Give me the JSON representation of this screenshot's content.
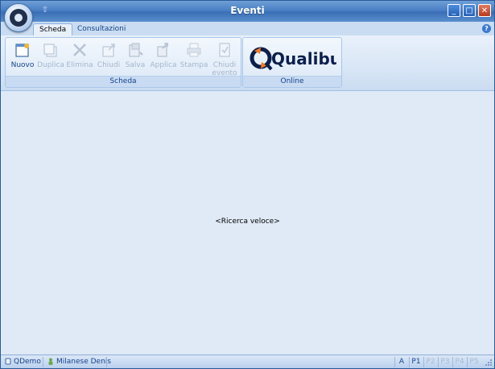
{
  "window": {
    "title": "Eventi"
  },
  "tabs": [
    {
      "label": "Scheda",
      "active": true
    },
    {
      "label": "Consultazioni",
      "active": false
    }
  ],
  "ribbon": {
    "scheda_group": {
      "label": "Scheda",
      "buttons": [
        {
          "label": "Nuovo",
          "enabled": true,
          "icon": "new-document-icon"
        },
        {
          "label": "Duplica",
          "enabled": false,
          "icon": "duplicate-icon"
        },
        {
          "label": "Elimina",
          "enabled": false,
          "icon": "delete-x-icon"
        },
        {
          "label": "Chiudi",
          "enabled": false,
          "icon": "close-folder-icon"
        },
        {
          "label": "Salva",
          "enabled": false,
          "icon": "save-icon"
        },
        {
          "label": "Applica",
          "enabled": false,
          "icon": "apply-icon"
        },
        {
          "label": "Stampa",
          "enabled": false,
          "icon": "printer-icon"
        },
        {
          "label": "Chiudi",
          "label2": "evento",
          "enabled": false,
          "icon": "close-event-icon"
        }
      ]
    },
    "online_group": {
      "label": "Online",
      "logo_text": "Qualibus"
    }
  },
  "content": {
    "quick_search": "<Ricerca veloce>"
  },
  "statusbar": {
    "company": "QDemo",
    "user": "Milanese Denis",
    "indicators": [
      {
        "label": "A",
        "enabled": true
      },
      {
        "label": "P1",
        "enabled": true
      },
      {
        "label": "P2",
        "enabled": false
      },
      {
        "label": "P3",
        "enabled": false
      },
      {
        "label": "P4",
        "enabled": false
      },
      {
        "label": "P5",
        "enabled": false
      }
    ]
  },
  "colors": {
    "titlebar": "#4a80c4",
    "ribbon_text": "#15428b",
    "content_bg": "#dfeaf6",
    "logo_orange": "#f47a20",
    "logo_navy": "#0b1f4d"
  }
}
